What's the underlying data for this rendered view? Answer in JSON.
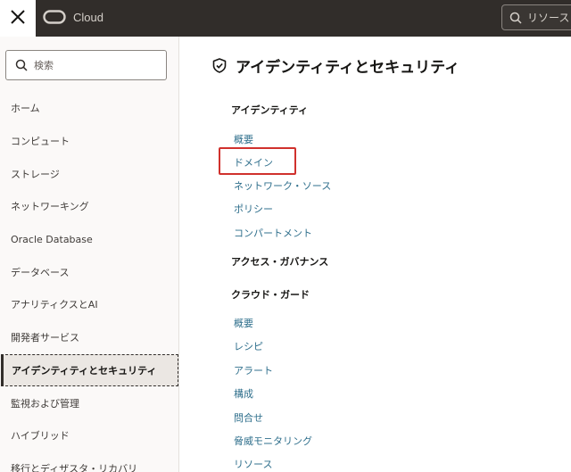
{
  "header": {
    "brand": "Cloud",
    "search_placeholder": "リソース"
  },
  "sidebar": {
    "search_placeholder": "検索",
    "items": [
      {
        "label": "ホーム"
      },
      {
        "label": "コンピュート"
      },
      {
        "label": "ストレージ"
      },
      {
        "label": "ネットワーキング"
      },
      {
        "label": "Oracle Database"
      },
      {
        "label": "データベース"
      },
      {
        "label": "アナリティクスとAI"
      },
      {
        "label": "開発者サービス"
      },
      {
        "label": "アイデンティティとセキュリティ",
        "active": true
      },
      {
        "label": "監視および管理"
      },
      {
        "label": "ハイブリッド"
      },
      {
        "label": "移行とディザスタ・リカバリ"
      }
    ]
  },
  "main": {
    "title": "アイデンティティとセキュリティ",
    "sections": [
      {
        "heading": "アイデンティティ",
        "links": [
          "概要",
          "ドメイン",
          "ネットワーク・ソース",
          "ポリシー",
          "コンパートメント"
        ]
      },
      {
        "heading": "アクセス・ガバナンス",
        "links": []
      },
      {
        "heading": "クラウド・ガード",
        "links": [
          "概要",
          "レシピ",
          "アラート",
          "構成",
          "問合せ",
          "脅威モニタリング",
          "リソース"
        ]
      }
    ]
  },
  "highlight": {
    "target": "ドメイン",
    "color": "#d0312d"
  }
}
